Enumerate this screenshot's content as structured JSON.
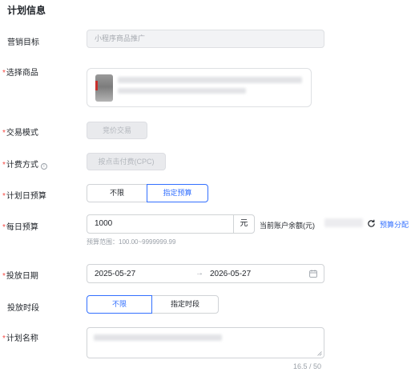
{
  "section_title": "计划信息",
  "fields": {
    "marketing_goal": {
      "label": "营销目标",
      "value": "小程序商品推广"
    },
    "product": {
      "label": "选择商品",
      "required": "*"
    },
    "trade_mode": {
      "label": "交易模式",
      "required": "*",
      "value": "竞价交易"
    },
    "billing": {
      "label": "计费方式",
      "required": "*",
      "value": "按点击付费(CPC)",
      "help_icon": "info-icon"
    },
    "daily_budget_type": {
      "label": "计划日预算",
      "required": "*",
      "options": [
        "不限",
        "指定预算"
      ],
      "selected": "指定预算"
    },
    "daily_budget": {
      "label": "每日预算",
      "required": "*",
      "value": "1000",
      "unit": "元",
      "hint": "预算范围：100.00~9999999.99",
      "balance_label": "当前账户余额(元)",
      "refresh_icon": "refresh-icon",
      "allocate_link": "预算分配"
    },
    "schedule_date": {
      "label": "投放日期",
      "required": "*",
      "start": "2025-05-27",
      "separator": "→",
      "end": "2026-05-27",
      "calendar_icon": "calendar-icon"
    },
    "schedule_time": {
      "label": "投放时段",
      "options": [
        "不限",
        "指定时段"
      ],
      "selected": "不限"
    },
    "plan_name": {
      "label": "计划名称",
      "required": "*",
      "counter": "16.5 / 50"
    }
  },
  "colors": {
    "accent": "#3370ff",
    "required": "#f54a45",
    "border": "#d0d3d6",
    "muted": "#9aa0a8"
  }
}
